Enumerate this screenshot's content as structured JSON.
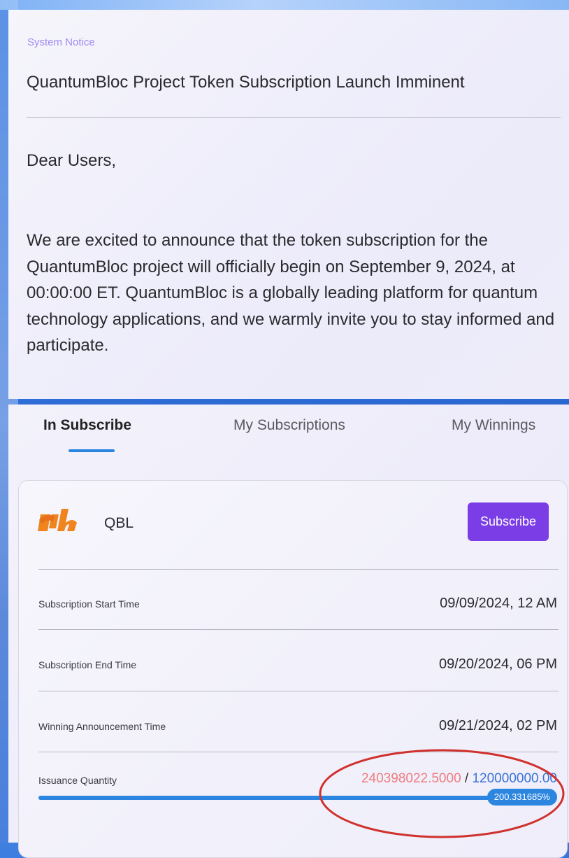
{
  "notice": {
    "label": "System Notice",
    "title": "QuantumBloc Project Token Subscription Launch Imminent",
    "greeting": "Dear Users,",
    "body": "We are excited to announce that the token subscription for the QuantumBloc project will officially begin on September 9, 2024, at 00:00:00 ET. QuantumBloc is a globally leading platform for quantum technology applications, and we warmly invite you to stay informed and participate."
  },
  "tabs": {
    "active": "In Subscribe",
    "items": [
      "In Subscribe",
      "My Subscriptions",
      "My Winnings"
    ]
  },
  "card": {
    "token_name": "QBL",
    "logo_icon": "qb-logo-icon",
    "subscribe_label": "Subscribe",
    "rows": [
      {
        "label": "Subscription Start Time",
        "value": "09/09/2024, 12 AM"
      },
      {
        "label": "Subscription End Time",
        "value": "09/20/2024, 06 PM"
      },
      {
        "label": "Winning Announcement Time",
        "value": "09/21/2024, 02 PM"
      }
    ],
    "issuance": {
      "label": "Issuance Quantity",
      "subscribed": "240398022.5000",
      "separator": " / ",
      "total": "120000000.00",
      "progress_text": "200.331685%",
      "progress_fraction": 2.00331685
    }
  },
  "colors": {
    "accent_purple": "#7a3de6",
    "progress_blue": "#2c86e0",
    "notice_label": "#a18af2",
    "subscribed_red": "#f07b7e",
    "total_blue": "#3a72d6",
    "annotation_red": "#d0312d"
  }
}
